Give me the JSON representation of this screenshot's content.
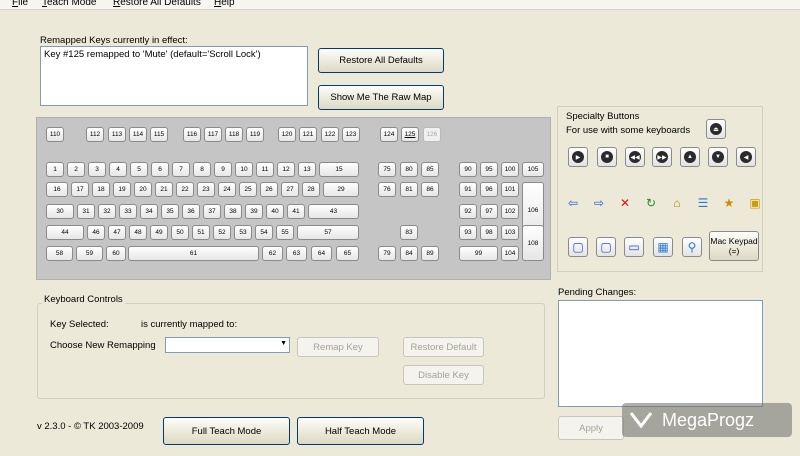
{
  "menu": [
    "File",
    "Teach Mode",
    "Restore All Defaults",
    "Help"
  ],
  "remapped": {
    "label": "Remapped Keys currently in effect:",
    "items": [
      "Key #125 remapped to 'Mute' (default='Scroll Lock')"
    ]
  },
  "buttons": {
    "restore_all": "Restore All Defaults",
    "show_raw": "Show Me The Raw Map",
    "remap_key": "Remap Key",
    "restore_default": "Restore Default",
    "disable_key": "Disable Key",
    "full_teach": "Full Teach Mode",
    "half_teach": "Half Teach Mode",
    "apply": "Apply"
  },
  "keyboard": {
    "fn_row": [
      "110",
      "112",
      "113",
      "114",
      "115",
      "116",
      "117",
      "118",
      "119",
      "120",
      "121",
      "122",
      "123",
      "124",
      "125",
      "126"
    ],
    "row1": [
      "1",
      "2",
      "3",
      "4",
      "5",
      "6",
      "7",
      "8",
      "9",
      "10",
      "11",
      "12",
      "13",
      "15"
    ],
    "row2": [
      "16",
      "17",
      "18",
      "19",
      "20",
      "21",
      "22",
      "23",
      "24",
      "25",
      "26",
      "27",
      "28",
      "29"
    ],
    "row3": [
      "30",
      "31",
      "32",
      "33",
      "34",
      "35",
      "36",
      "37",
      "38",
      "39",
      "40",
      "41",
      "43"
    ],
    "row4": [
      "44",
      "46",
      "47",
      "48",
      "49",
      "50",
      "51",
      "52",
      "53",
      "54",
      "55",
      "57"
    ],
    "row5": [
      "58",
      "59",
      "60",
      "61",
      "62",
      "63",
      "64",
      "65"
    ],
    "nav": [
      "75",
      "80",
      "85",
      "76",
      "81",
      "86",
      "83",
      "79",
      "84",
      "89"
    ],
    "numpad": [
      "90",
      "95",
      "100",
      "105",
      "91",
      "96",
      "101",
      "92",
      "97",
      "102",
      "106",
      "93",
      "98",
      "103",
      "99",
      "104",
      "108"
    ]
  },
  "specialty": {
    "title": "Specialty Buttons",
    "subtitle": "For use with some keyboards",
    "mac_keypad": "Mac Keypad (=)",
    "icons": [
      "eject-icon",
      "play-icon",
      "stop-icon",
      "prev-track-icon",
      "next-track-icon",
      "volume-up-icon",
      "volume-down-icon",
      "mute-icon",
      "back-arrow-icon",
      "forward-arrow-icon",
      "stop-red-icon",
      "refresh-icon",
      "home-icon",
      "search-doc-icon",
      "favorites-icon",
      "folder-icon",
      "window-icon",
      "window2-icon",
      "computer-icon",
      "calculator-icon",
      "search-icon"
    ]
  },
  "controls": {
    "title": "Keyboard Controls",
    "key_selected": "Key Selected:",
    "mapped_to": "is currently mapped to:",
    "choose": "Choose New Remapping"
  },
  "pending": {
    "label": "Pending Changes:"
  },
  "version": "v 2.3.0 - © TK 2003-2009",
  "watermark": "MegaProgz"
}
